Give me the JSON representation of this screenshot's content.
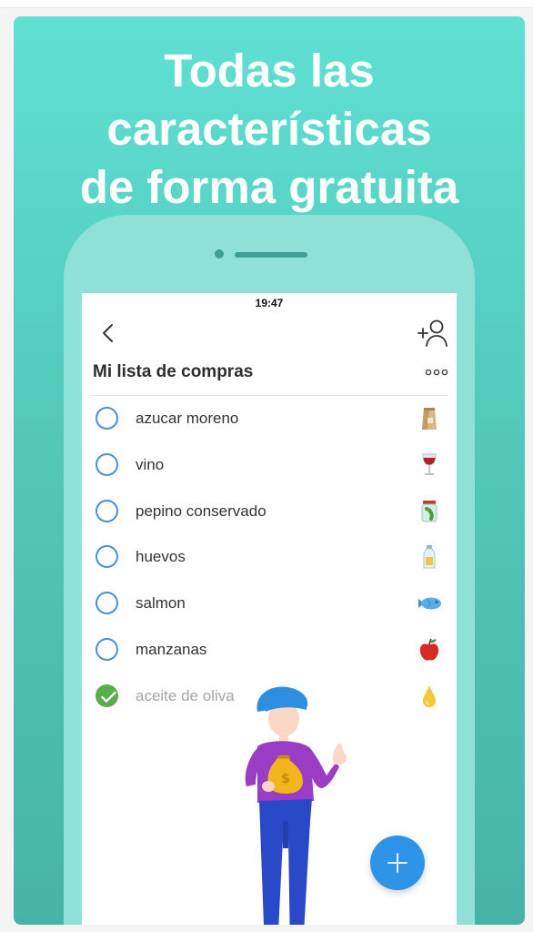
{
  "promo": {
    "headline": [
      "Todas las",
      "características",
      "de forma gratuita"
    ]
  },
  "status_bar": {
    "time": "19:47"
  },
  "list": {
    "title": "Mi lista de compras",
    "items": [
      {
        "label": "azucar moreno",
        "icon": "sugar-bag-icon",
        "checked": false
      },
      {
        "label": "vino",
        "icon": "wine-glass-icon",
        "checked": false
      },
      {
        "label": "pepino conservado",
        "icon": "pickle-jar-icon",
        "checked": false
      },
      {
        "label": "huevos",
        "icon": "milk-bottle-icon",
        "checked": false
      },
      {
        "label": "salmon",
        "icon": "fish-icon",
        "checked": false
      },
      {
        "label": "manzanas",
        "icon": "apple-icon",
        "checked": false
      },
      {
        "label": "aceite de oliva",
        "icon": "oil-drop-icon",
        "checked": true
      }
    ]
  },
  "colors": {
    "accent": "#2e94e8",
    "checkbox_border": "#4b8fd6",
    "checked": "#5aac4c",
    "background_teal": "#52c9bb"
  }
}
